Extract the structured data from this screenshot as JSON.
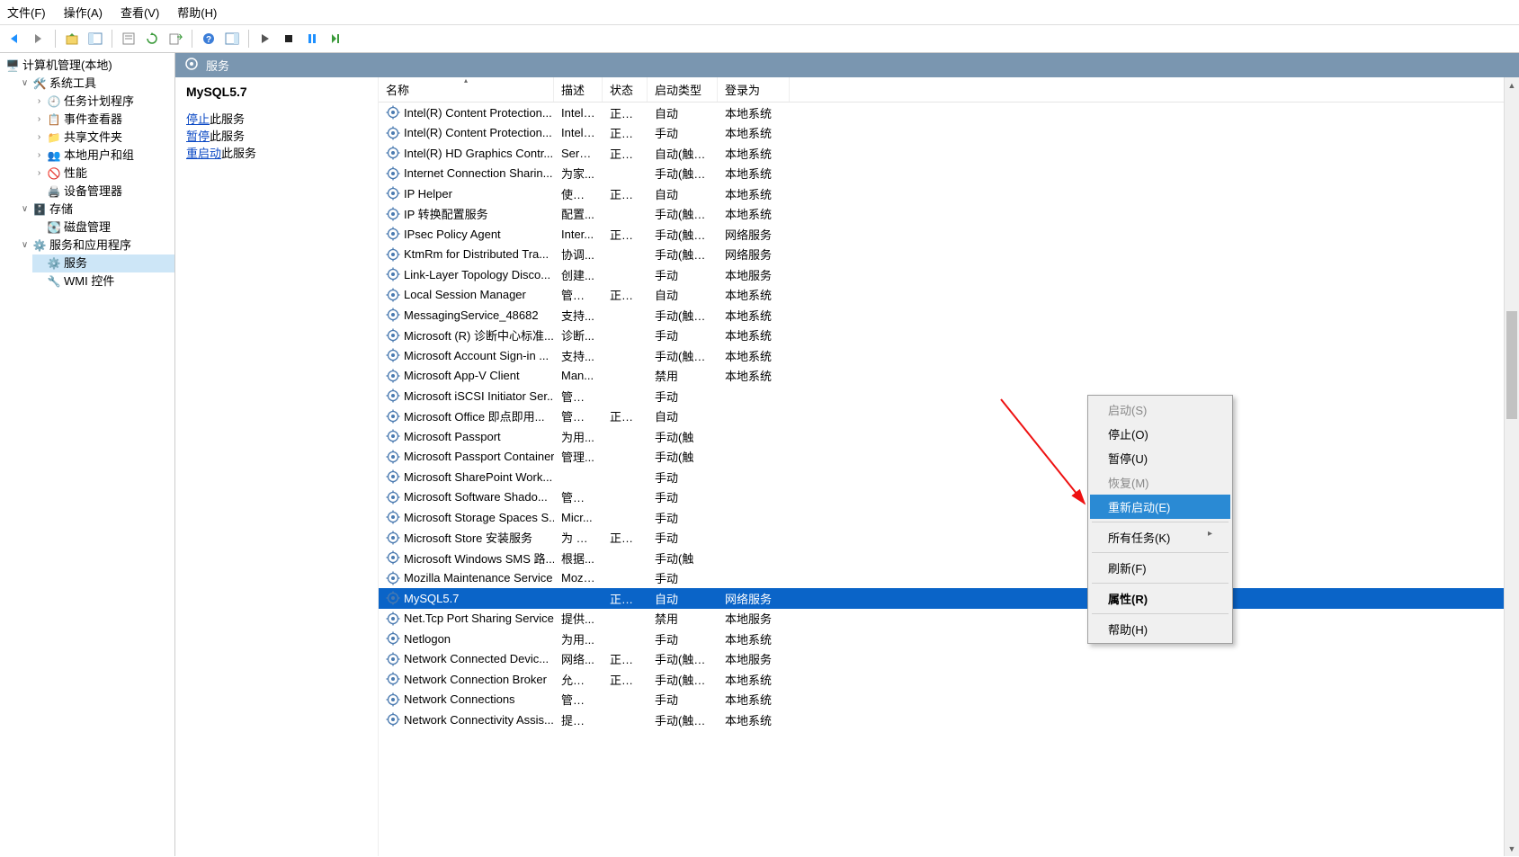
{
  "menu": {
    "file": "文件(F)",
    "action": "操作(A)",
    "view": "查看(V)",
    "help": "帮助(H)"
  },
  "tree": {
    "root": "计算机管理(本地)",
    "sys_tools": "系统工具",
    "task_sched": "任务计划程序",
    "event_viewer": "事件查看器",
    "shared": "共享文件夹",
    "local_users": "本地用户和组",
    "perf": "性能",
    "dev_mgr": "设备管理器",
    "storage": "存储",
    "disk_mgmt": "磁盘管理",
    "svc_app": "服务和应用程序",
    "services": "服务",
    "wmi": "WMI 控件"
  },
  "pane": {
    "header": "服务",
    "selected_name": "MySQL5.7",
    "stop_link": "停止",
    "stop_suffix": "此服务",
    "pause_link": "暂停",
    "pause_suffix": "此服务",
    "restart_link": "重启动",
    "restart_suffix": "此服务"
  },
  "columns": {
    "name": "名称",
    "desc": "描述",
    "state": "状态",
    "start": "启动类型",
    "logon": "登录为"
  },
  "services": [
    {
      "name": "Intel(R) Content Protection...",
      "desc": "Intel(...",
      "state": "正在...",
      "start": "自动",
      "logon": "本地系统"
    },
    {
      "name": "Intel(R) Content Protection...",
      "desc": "Intel(...",
      "state": "正在...",
      "start": "手动",
      "logon": "本地系统"
    },
    {
      "name": "Intel(R) HD Graphics Contr...",
      "desc": "Servi...",
      "state": "正在...",
      "start": "自动(触发...",
      "logon": "本地系统"
    },
    {
      "name": "Internet Connection Sharin...",
      "desc": "为家...",
      "state": "",
      "start": "手动(触发...",
      "logon": "本地系统"
    },
    {
      "name": "IP Helper",
      "desc": "使用 ...",
      "state": "正在...",
      "start": "自动",
      "logon": "本地系统"
    },
    {
      "name": "IP 转换配置服务",
      "desc": "配置...",
      "state": "",
      "start": "手动(触发...",
      "logon": "本地系统"
    },
    {
      "name": "IPsec Policy Agent",
      "desc": "Inter...",
      "state": "正在...",
      "start": "手动(触发...",
      "logon": "网络服务"
    },
    {
      "name": "KtmRm for Distributed Tra...",
      "desc": "协调...",
      "state": "",
      "start": "手动(触发...",
      "logon": "网络服务"
    },
    {
      "name": "Link-Layer Topology Disco...",
      "desc": "创建...",
      "state": "",
      "start": "手动",
      "logon": "本地服务"
    },
    {
      "name": "Local Session Manager",
      "desc": "管理 ...",
      "state": "正在...",
      "start": "自动",
      "logon": "本地系统"
    },
    {
      "name": "MessagingService_48682",
      "desc": "支持...",
      "state": "",
      "start": "手动(触发...",
      "logon": "本地系统"
    },
    {
      "name": "Microsoft (R) 诊断中心标准...",
      "desc": "诊断...",
      "state": "",
      "start": "手动",
      "logon": "本地系统"
    },
    {
      "name": "Microsoft Account Sign-in ...",
      "desc": "支持...",
      "state": "",
      "start": "手动(触发...",
      "logon": "本地系统"
    },
    {
      "name": "Microsoft App-V Client",
      "desc": "Man...",
      "state": "",
      "start": "禁用",
      "logon": "本地系统"
    },
    {
      "name": "Microsoft iSCSI Initiator Ser...",
      "desc": "管理 ...",
      "state": "",
      "start": "手动",
      "logon": ""
    },
    {
      "name": "Microsoft Office 即点即用...",
      "desc": "管理 ...",
      "state": "正在...",
      "start": "自动",
      "logon": ""
    },
    {
      "name": "Microsoft Passport",
      "desc": "为用...",
      "state": "",
      "start": "手动(触",
      "logon": ""
    },
    {
      "name": "Microsoft Passport Container",
      "desc": "管理...",
      "state": "",
      "start": "手动(触",
      "logon": ""
    },
    {
      "name": "Microsoft SharePoint Work...",
      "desc": "",
      "state": "",
      "start": "手动",
      "logon": ""
    },
    {
      "name": "Microsoft Software Shado...",
      "desc": "管理 ...",
      "state": "",
      "start": "手动",
      "logon": ""
    },
    {
      "name": "Microsoft Storage Spaces S...",
      "desc": "Micr...",
      "state": "",
      "start": "手动",
      "logon": ""
    },
    {
      "name": "Microsoft Store 安装服务",
      "desc": "为 M...",
      "state": "正在...",
      "start": "手动",
      "logon": ""
    },
    {
      "name": "Microsoft Windows SMS 路...",
      "desc": "根据...",
      "state": "",
      "start": "手动(触",
      "logon": ""
    },
    {
      "name": "Mozilla Maintenance Service",
      "desc": "Mozi...",
      "state": "",
      "start": "手动",
      "logon": ""
    },
    {
      "name": "MySQL5.7",
      "desc": "",
      "state": "正在...",
      "start": "自动",
      "logon": "网络服务",
      "selected": true
    },
    {
      "name": "Net.Tcp Port Sharing Service",
      "desc": "提供...",
      "state": "",
      "start": "禁用",
      "logon": "本地服务"
    },
    {
      "name": "Netlogon",
      "desc": "为用...",
      "state": "",
      "start": "手动",
      "logon": "本地系统"
    },
    {
      "name": "Network Connected Devic...",
      "desc": "网络...",
      "state": "正在...",
      "start": "手动(触发...",
      "logon": "本地服务"
    },
    {
      "name": "Network Connection Broker",
      "desc": "允许 ...",
      "state": "正在...",
      "start": "手动(触发...",
      "logon": "本地系统"
    },
    {
      "name": "Network Connections",
      "desc": "管理\"...",
      "state": "",
      "start": "手动",
      "logon": "本地系统"
    },
    {
      "name": "Network Connectivity Assis...",
      "desc": "提供 ...",
      "state": "",
      "start": "手动(触发...",
      "logon": "本地系统"
    }
  ],
  "context": {
    "start": "启动(S)",
    "stop": "停止(O)",
    "pause": "暂停(U)",
    "resume": "恢复(M)",
    "restart": "重新启动(E)",
    "all_tasks": "所有任务(K)",
    "refresh": "刷新(F)",
    "properties": "属性(R)",
    "help": "帮助(H)"
  }
}
